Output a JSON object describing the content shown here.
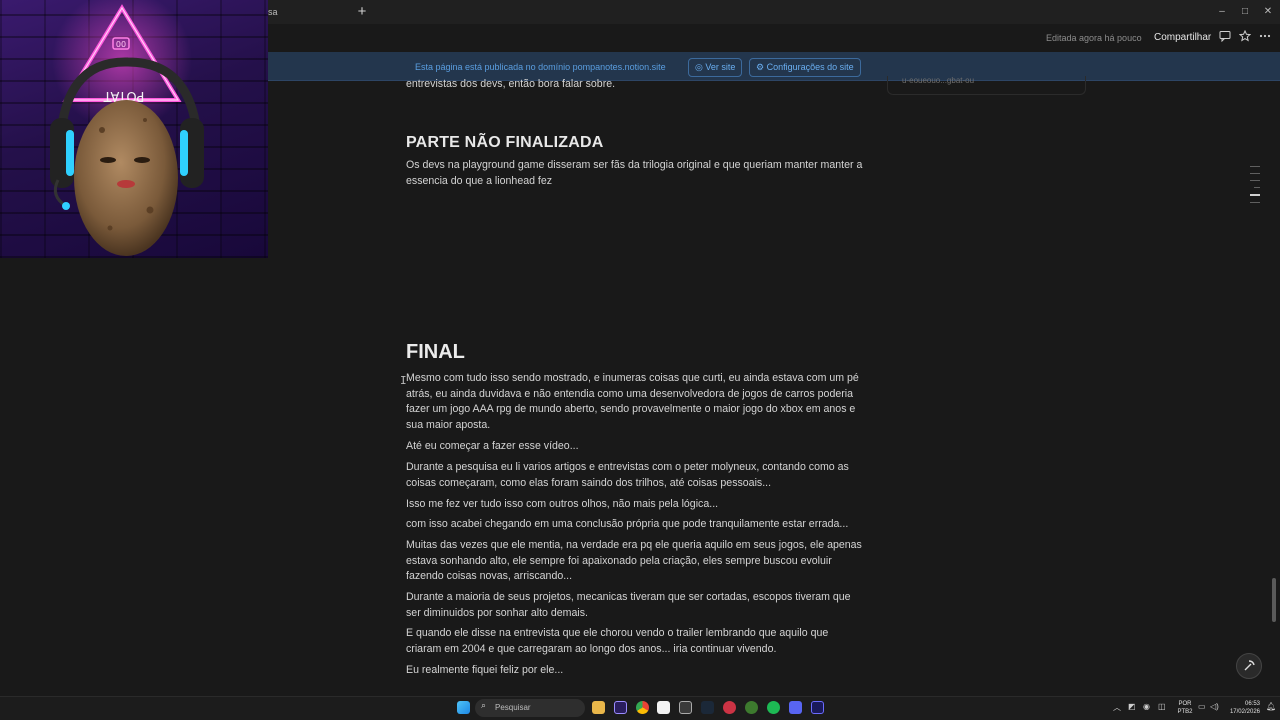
{
  "browser": {
    "tab_title": "sa",
    "new_tab": "+",
    "window_controls": [
      "–",
      "□",
      "✕"
    ]
  },
  "notion_topbar": {
    "edited": "Editada agora há pouco",
    "share": "Compartilhar"
  },
  "banner": {
    "text": "Esta página está publicada no domínio pompanotes.notion.site",
    "view_site": "Ver site",
    "site_settings": "Configurações do site"
  },
  "right_panel_text": "u-eoueouo...gbat-ou",
  "content": {
    "intro_tail": "entrevistas dos devs, então bora falar sobre.",
    "heading_partial": "PARTE NÃO FINALIZADA",
    "partial_p1": "Os devs na playground game disseram ser fãs da trilogia original e que queriam manter manter a essencia do que a lionhead fez",
    "heading_final": "FINAL",
    "final_p1": "Mesmo com tudo isso sendo mostrado, e inumeras coisas que curti, eu ainda estava com um pé atrás, eu ainda duvidava e não entendia como uma desenvolvedora de jogos de carros poderia fazer um jogo AAA rpg de mundo aberto, sendo provavelmente o maior jogo do xbox em anos e sua maior aposta.",
    "final_p2": "Até eu começar a fazer esse vídeo...",
    "final_p3": "Durante a pesquisa eu li varios artigos e entrevistas com o peter molyneux, contando como as coisas começaram, como elas foram saindo dos trilhos, até coisas pessoais...",
    "final_p4": "Isso me fez ver tudo isso com outros olhos, não mais pela lógica...",
    "final_p5": "com isso acabei chegando em uma conclusão própria que pode tranquilamente estar errada...",
    "final_p6": "Muitas das vezes que ele mentia, na verdade era pq ele queria aquilo em seus jogos, ele apenas estava sonhando alto, ele sempre foi apaixonado pela criação, eles sempre buscou evoluir fazendo coisas novas, arriscando...",
    "final_p7": "Durante a maioria de seus projetos, mecanicas tiveram que ser cortadas, escopos tiveram que ser diminuidos por sonhar alto demais.",
    "final_p8": "E quando ele disse na entrevista que ele chorou vendo o trailer lembrando que aquilo que criaram em 2004 e que carregaram ao longo dos anos... iria continuar vivendo.",
    "final_p9": "Eu realmente fiquei feliz por ele..."
  },
  "webcam": {
    "sign_text": "POTAT",
    "sign_top": "00"
  },
  "taskbar": {
    "search": "Pesquisar",
    "lang_line1": "POR",
    "lang_line2": "PTB2",
    "time": "06:53",
    "date": "17/02/2026"
  },
  "colors": {
    "background": "#191919",
    "banner": "#23364d",
    "link_blue": "#5a9ee0",
    "neon_pink": "#ff3bd0"
  }
}
